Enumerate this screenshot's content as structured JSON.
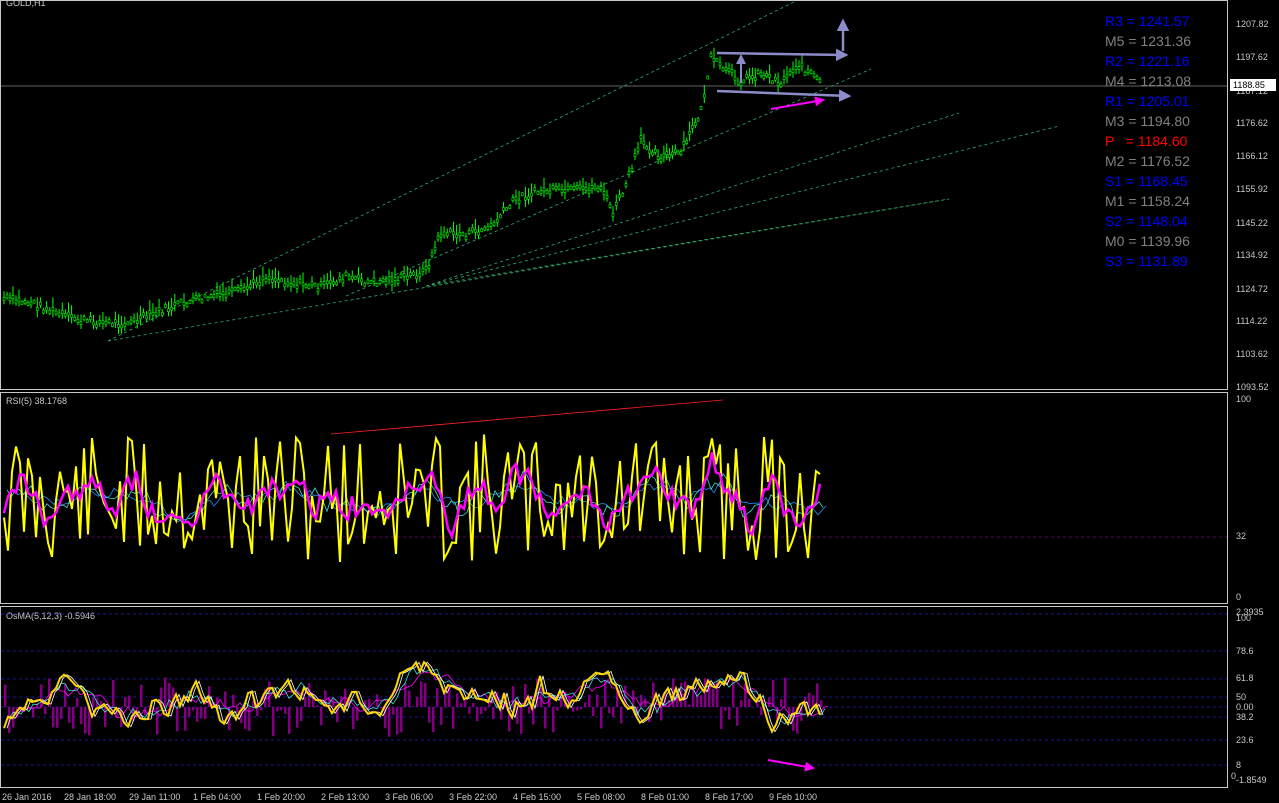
{
  "chart_title": "GOLD,H1",
  "colors": {
    "background": "#000000",
    "candles": "#00ff00",
    "axis_text": "#c8c8c8",
    "resistance": "#0000ff",
    "mid": "#808080",
    "pivot": "#ff0000",
    "rsi_main": "#ffff00",
    "rsi_signal": "#ff00ff",
    "osma_hist": "#800080",
    "arrow_magenta": "#ff00ff",
    "channel_arrow": "#8c8cc8"
  },
  "price_axis": {
    "ticks": [
      "1207.82",
      "1197.62",
      "1187.12",
      "1176.62",
      "1166.12",
      "1155.92",
      "1145.22",
      "1134.92",
      "1124.72",
      "1114.22",
      "1103.62",
      "1093.52"
    ],
    "current_price": "1188.85"
  },
  "pivots": [
    {
      "label": "R3 = 1241.57",
      "color": "#0000ff"
    },
    {
      "label": "M5 = 1231.36",
      "color": "#808080"
    },
    {
      "label": "R2 = 1221.16",
      "color": "#0000ff"
    },
    {
      "label": "M4 = 1213.08",
      "color": "#808080"
    },
    {
      "label": "R1 = 1205.01",
      "color": "#0000ff"
    },
    {
      "label": "M3 = 1194.80",
      "color": "#808080"
    },
    {
      "label": "P   = 1184.60",
      "color": "#ff0000"
    },
    {
      "label": "M2 = 1176.52",
      "color": "#808080"
    },
    {
      "label": "S1 = 1168.45",
      "color": "#0000ff"
    },
    {
      "label": "M1 = 1158.24",
      "color": "#808080"
    },
    {
      "label": "S2 = 1148.04",
      "color": "#0000ff"
    },
    {
      "label": "M0 = 1139.96",
      "color": "#808080"
    },
    {
      "label": "S3 = 1131.89",
      "color": "#0000ff"
    }
  ],
  "rsi": {
    "title": "RSI(5) 38.1768",
    "axis": [
      "100",
      "32",
      "0"
    ]
  },
  "osma": {
    "title": "OsMA(5,12,3) -0.5946",
    "axis": [
      "2.3935",
      "100",
      "78.6",
      "61.8",
      "50",
      "0.00",
      "38.2",
      "23.6",
      "8",
      "0",
      "-1.8549"
    ]
  },
  "time_axis": [
    "26 Jan 2016",
    "28 Jan 18:00",
    "29 Jan 11:00",
    "1 Feb 04:00",
    "1 Feb 20:00",
    "2 Feb 13:00",
    "3 Feb 06:00",
    "3 Feb 22:00",
    "4 Feb 15:00",
    "5 Feb 08:00",
    "8 Feb 01:00",
    "8 Feb 17:00",
    "9 Feb 10:00"
  ]
}
